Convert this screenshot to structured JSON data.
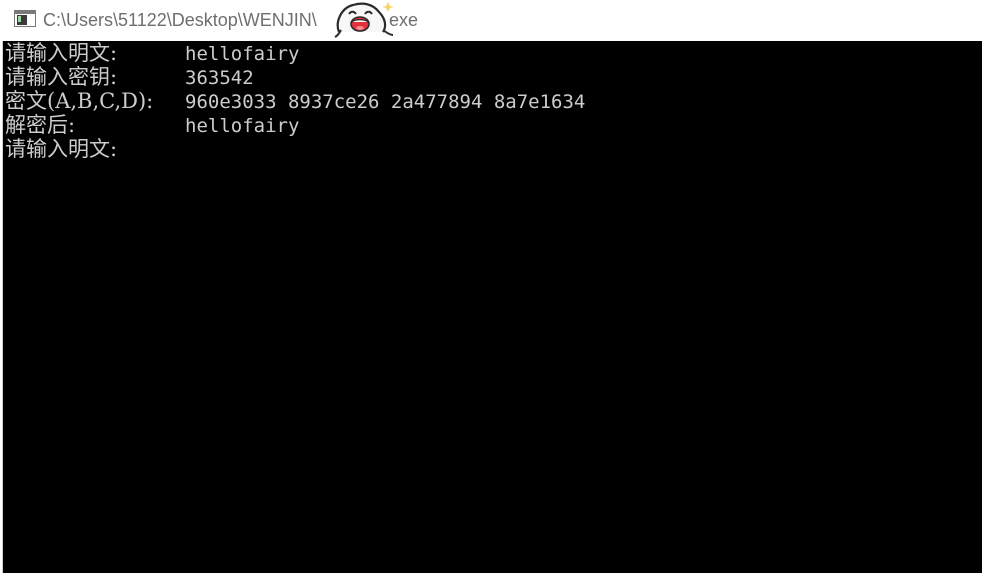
{
  "window": {
    "title": "C:\\Users\\51122\\Desktop\\WENJIN\\",
    "title_suffix": "exe",
    "app_icon": "console-window-icon",
    "overlay_sticker": "cartoon-face-sticker"
  },
  "console": {
    "background": "#000000",
    "text_color": "#cccccc",
    "lines": [
      {
        "label": "请输入明文:",
        "value": "hellofairy"
      },
      {
        "label": "请输入密钥:",
        "value": "363542"
      },
      {
        "label": "密文(A,B,C,D):",
        "value": "960e3033 8937ce26 2a477894 8a7e1634"
      },
      {
        "label": "解密后:",
        "value": "hellofairy"
      },
      {
        "label": "请输入明文:",
        "value": ""
      }
    ]
  }
}
